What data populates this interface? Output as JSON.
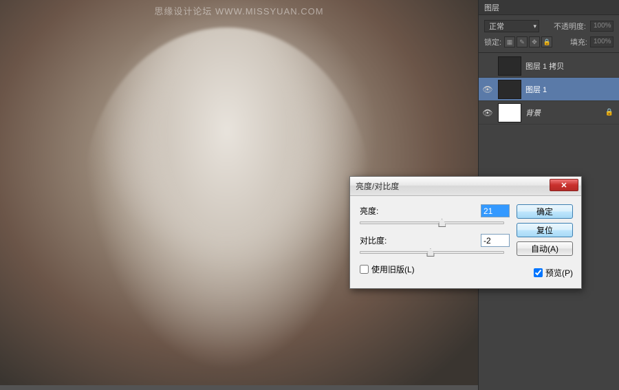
{
  "watermark": "思缘设计论坛   WWW.MISSYUAN.COM",
  "panel": {
    "tab": "图层",
    "blend_mode": "正常",
    "opacity_label": "不透明度:",
    "opacity_value": "100%",
    "lock_label": "锁定:",
    "fill_label": "填充:",
    "fill_value": "100%"
  },
  "layers": [
    {
      "visible": false,
      "name": "图层 1 拷贝",
      "thumb": "dark",
      "locked": false
    },
    {
      "visible": true,
      "name": "图层 1",
      "thumb": "dark",
      "locked": false,
      "selected": true
    },
    {
      "visible": true,
      "name": "背景",
      "thumb": "white",
      "locked": true
    }
  ],
  "dialog": {
    "title": "亮度/对比度",
    "brightness_label": "亮度:",
    "brightness_value": "21",
    "contrast_label": "对比度:",
    "contrast_value": "-2",
    "legacy_label": "使用旧版(L)",
    "preview_label": "预览(P)",
    "ok": "确定",
    "reset": "复位",
    "auto": "自动(A)",
    "close_glyph": "✕"
  }
}
